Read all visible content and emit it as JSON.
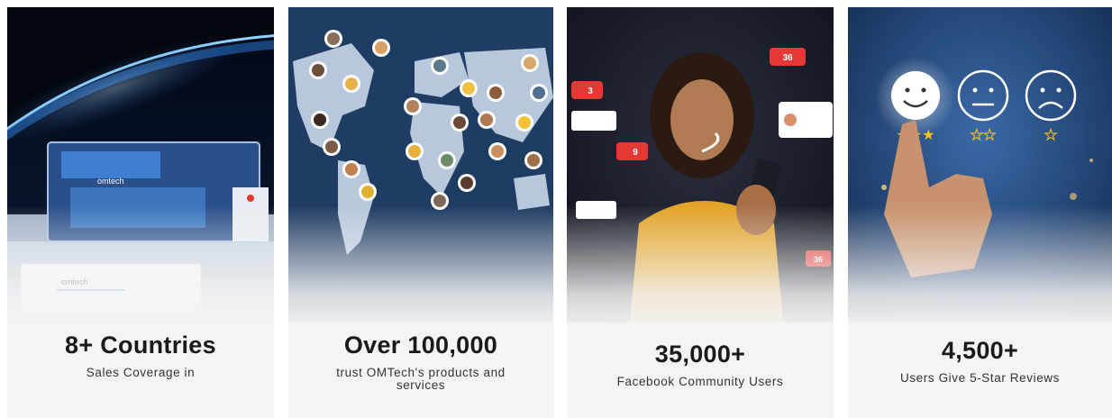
{
  "cards": [
    {
      "title": "8+ Countries",
      "subtitle": "Sales Coverage in",
      "image": "laser-engraver-earth-image",
      "logo_text": "omtech"
    },
    {
      "title": "Over 100,000",
      "subtitle": "trust OMTech's products and services",
      "image": "world-map-users-image"
    },
    {
      "title": "35,000+",
      "subtitle": "Facebook Community Users",
      "image": "woman-phone-social-image",
      "reaction_counts": [
        "36",
        "3",
        "9",
        "36"
      ]
    },
    {
      "title": "4,500+",
      "subtitle": "Users Give 5-Star Reviews",
      "image": "rating-faces-image"
    }
  ],
  "colors": {
    "accent_yellow": "#f5c518",
    "space_blue": "#0b1d3a",
    "map_blue": "#1f3c63",
    "social_red": "#e53935"
  }
}
